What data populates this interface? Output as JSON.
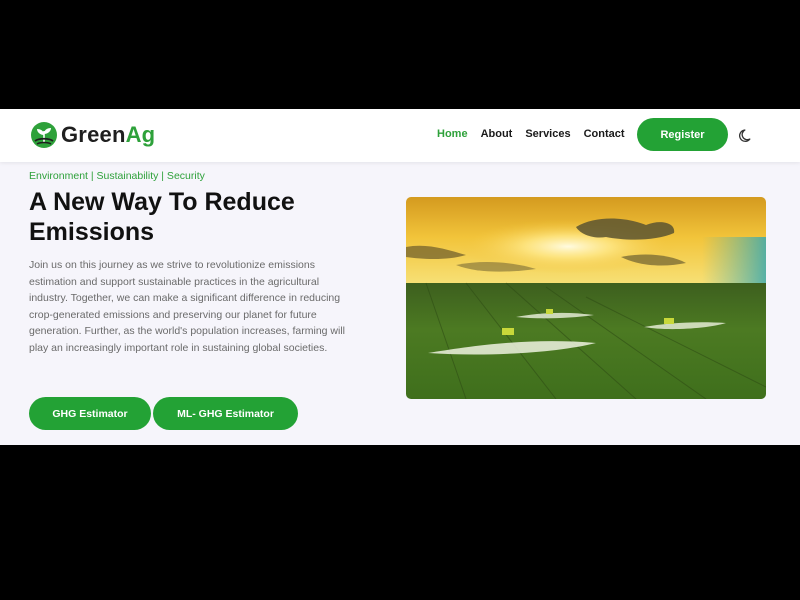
{
  "brand": {
    "name_part1": "Green",
    "name_part2": "Ag",
    "logo": "leaf-sprout-logo"
  },
  "nav": {
    "links": [
      {
        "label": "Home",
        "active": true
      },
      {
        "label": "About",
        "active": false
      },
      {
        "label": "Services",
        "active": false
      },
      {
        "label": "Contact",
        "active": false
      }
    ],
    "register_label": "Register",
    "theme_toggle_icon": "moon-icon"
  },
  "hero": {
    "tags": "Environment | Sustainability | Security",
    "headline": "A New Way To Reduce Emissions",
    "body": "Join us on this journey as we strive to revolutionize emissions estimation and support sustainable practices in the agricultural industry. Together, we can make a significant difference in reducing crop-generated emissions and preserving our planet for future generation. Further, as the world's population increases, farming will play an increasingly important role in sustaining global societies.",
    "buttons": {
      "ghg": "GHG Estimator",
      "ml_ghg": "ML- GHG Estimator"
    },
    "image": "tractors-spraying-green-field-at-sunset"
  },
  "colors": {
    "accent": "#23a235",
    "page_bg": "#f6f5fb",
    "letterbox": "#000000"
  }
}
